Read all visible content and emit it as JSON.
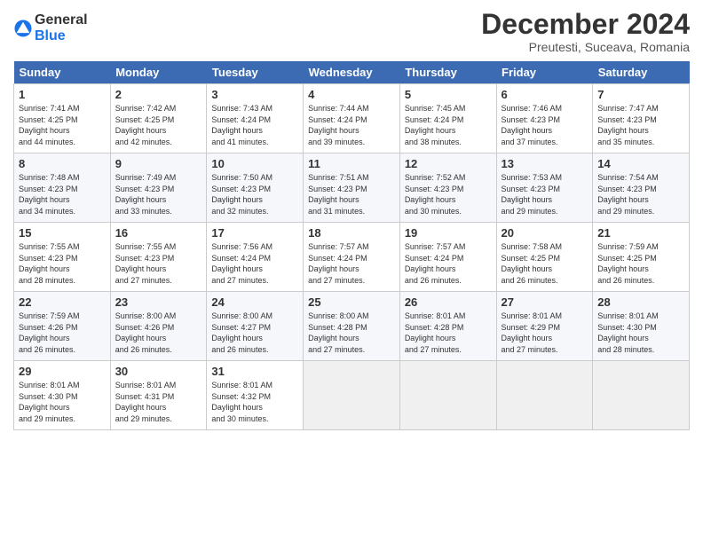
{
  "header": {
    "logo_line1": "General",
    "logo_line2": "Blue",
    "month_title": "December 2024",
    "location": "Preutesti, Suceava, Romania"
  },
  "weekdays": [
    "Sunday",
    "Monday",
    "Tuesday",
    "Wednesday",
    "Thursday",
    "Friday",
    "Saturday"
  ],
  "weeks": [
    [
      {
        "day": "1",
        "sunrise": "7:41 AM",
        "sunset": "4:25 PM",
        "daylight": "8 hours and 44 minutes."
      },
      {
        "day": "2",
        "sunrise": "7:42 AM",
        "sunset": "4:25 PM",
        "daylight": "8 hours and 42 minutes."
      },
      {
        "day": "3",
        "sunrise": "7:43 AM",
        "sunset": "4:24 PM",
        "daylight": "8 hours and 41 minutes."
      },
      {
        "day": "4",
        "sunrise": "7:44 AM",
        "sunset": "4:24 PM",
        "daylight": "8 hours and 39 minutes."
      },
      {
        "day": "5",
        "sunrise": "7:45 AM",
        "sunset": "4:24 PM",
        "daylight": "8 hours and 38 minutes."
      },
      {
        "day": "6",
        "sunrise": "7:46 AM",
        "sunset": "4:23 PM",
        "daylight": "8 hours and 37 minutes."
      },
      {
        "day": "7",
        "sunrise": "7:47 AM",
        "sunset": "4:23 PM",
        "daylight": "8 hours and 35 minutes."
      }
    ],
    [
      {
        "day": "8",
        "sunrise": "7:48 AM",
        "sunset": "4:23 PM",
        "daylight": "8 hours and 34 minutes."
      },
      {
        "day": "9",
        "sunrise": "7:49 AM",
        "sunset": "4:23 PM",
        "daylight": "8 hours and 33 minutes."
      },
      {
        "day": "10",
        "sunrise": "7:50 AM",
        "sunset": "4:23 PM",
        "daylight": "8 hours and 32 minutes."
      },
      {
        "day": "11",
        "sunrise": "7:51 AM",
        "sunset": "4:23 PM",
        "daylight": "8 hours and 31 minutes."
      },
      {
        "day": "12",
        "sunrise": "7:52 AM",
        "sunset": "4:23 PM",
        "daylight": "8 hours and 30 minutes."
      },
      {
        "day": "13",
        "sunrise": "7:53 AM",
        "sunset": "4:23 PM",
        "daylight": "8 hours and 29 minutes."
      },
      {
        "day": "14",
        "sunrise": "7:54 AM",
        "sunset": "4:23 PM",
        "daylight": "8 hours and 29 minutes."
      }
    ],
    [
      {
        "day": "15",
        "sunrise": "7:55 AM",
        "sunset": "4:23 PM",
        "daylight": "8 hours and 28 minutes."
      },
      {
        "day": "16",
        "sunrise": "7:55 AM",
        "sunset": "4:23 PM",
        "daylight": "8 hours and 27 minutes."
      },
      {
        "day": "17",
        "sunrise": "7:56 AM",
        "sunset": "4:24 PM",
        "daylight": "8 hours and 27 minutes."
      },
      {
        "day": "18",
        "sunrise": "7:57 AM",
        "sunset": "4:24 PM",
        "daylight": "8 hours and 27 minutes."
      },
      {
        "day": "19",
        "sunrise": "7:57 AM",
        "sunset": "4:24 PM",
        "daylight": "8 hours and 26 minutes."
      },
      {
        "day": "20",
        "sunrise": "7:58 AM",
        "sunset": "4:25 PM",
        "daylight": "8 hours and 26 minutes."
      },
      {
        "day": "21",
        "sunrise": "7:59 AM",
        "sunset": "4:25 PM",
        "daylight": "8 hours and 26 minutes."
      }
    ],
    [
      {
        "day": "22",
        "sunrise": "7:59 AM",
        "sunset": "4:26 PM",
        "daylight": "8 hours and 26 minutes."
      },
      {
        "day": "23",
        "sunrise": "8:00 AM",
        "sunset": "4:26 PM",
        "daylight": "8 hours and 26 minutes."
      },
      {
        "day": "24",
        "sunrise": "8:00 AM",
        "sunset": "4:27 PM",
        "daylight": "8 hours and 26 minutes."
      },
      {
        "day": "25",
        "sunrise": "8:00 AM",
        "sunset": "4:28 PM",
        "daylight": "8 hours and 27 minutes."
      },
      {
        "day": "26",
        "sunrise": "8:01 AM",
        "sunset": "4:28 PM",
        "daylight": "8 hours and 27 minutes."
      },
      {
        "day": "27",
        "sunrise": "8:01 AM",
        "sunset": "4:29 PM",
        "daylight": "8 hours and 27 minutes."
      },
      {
        "day": "28",
        "sunrise": "8:01 AM",
        "sunset": "4:30 PM",
        "daylight": "8 hours and 28 minutes."
      }
    ],
    [
      {
        "day": "29",
        "sunrise": "8:01 AM",
        "sunset": "4:30 PM",
        "daylight": "8 hours and 29 minutes."
      },
      {
        "day": "30",
        "sunrise": "8:01 AM",
        "sunset": "4:31 PM",
        "daylight": "8 hours and 29 minutes."
      },
      {
        "day": "31",
        "sunrise": "8:01 AM",
        "sunset": "4:32 PM",
        "daylight": "8 hours and 30 minutes."
      },
      null,
      null,
      null,
      null
    ]
  ]
}
